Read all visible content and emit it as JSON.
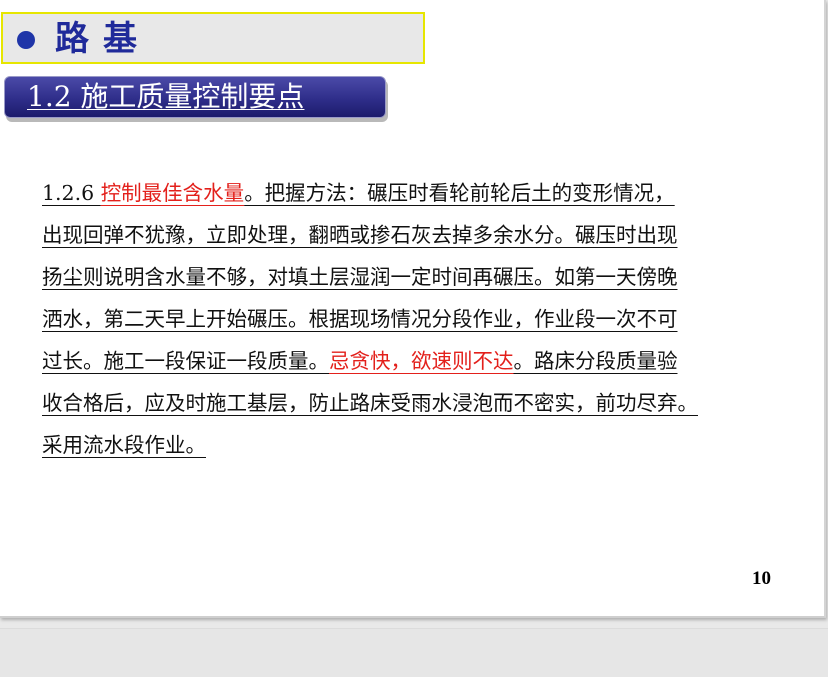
{
  "title": {
    "text": "路基"
  },
  "subtitle": {
    "text": "1.2 施工质量控制要点"
  },
  "body": {
    "lines": [
      [
        {
          "text": "1.2.6 ",
          "emphasis": false
        },
        {
          "text": "控制最佳含水量",
          "emphasis": true
        },
        {
          "text": "。把握方法：碾压时看轮前轮后土的变形情况，",
          "emphasis": false
        }
      ],
      [
        {
          "text": "出现回弹不犹豫，立即处理，翻晒或掺石灰去掉多余水分。碾压时出现",
          "emphasis": false
        }
      ],
      [
        {
          "text": "扬尘则说明含水量不够，对填土层湿润一定时间再碾压。如第一天傍晚",
          "emphasis": false
        }
      ],
      [
        {
          "text": "洒水，第二天早上开始碾压。根据现场情况分段作业，作业段一次不可",
          "emphasis": false
        }
      ],
      [
        {
          "text": "过长。施工一段保证一段质量。",
          "emphasis": false
        },
        {
          "text": "忌贪快，欲速则不达",
          "emphasis": true
        },
        {
          "text": "。路床分段质量验",
          "emphasis": false
        }
      ],
      [
        {
          "text": "收合格后，应及时施工基层，防止路床受雨水浸泡而不密实，前功尽弃。",
          "emphasis": false
        }
      ],
      [
        {
          "text": "采用流水段作业。",
          "emphasis": false
        }
      ]
    ]
  },
  "page_number": "10",
  "colors": {
    "title_text": "#1f2a9a",
    "title_bar_border": "#e6e600",
    "subtitle_bar": "#2f2e8a",
    "emphasis_text": "#e3201b"
  }
}
